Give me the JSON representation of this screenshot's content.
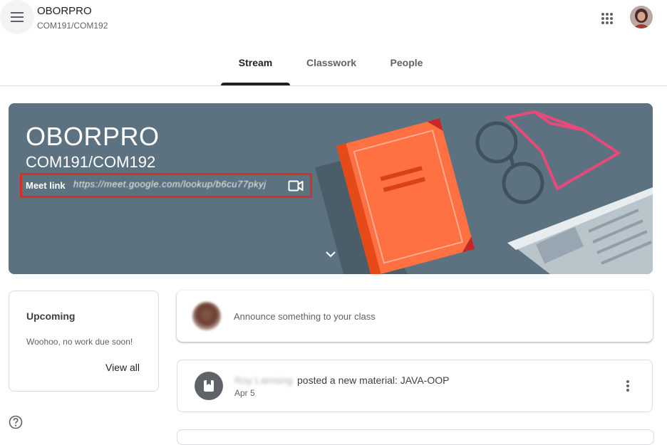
{
  "header": {
    "title": "OBORPRO",
    "subtitle": "COM191/COM192",
    "menu_icon": "hamburger-menu-icon",
    "apps_icon": "apps-grid-icon"
  },
  "tabs": [
    {
      "label": "Stream",
      "active": true
    },
    {
      "label": "Classwork",
      "active": false
    },
    {
      "label": "People",
      "active": false
    }
  ],
  "banner": {
    "title": "OBORPRO",
    "subtitle": "COM191/COM192",
    "meet_label": "Meet link",
    "meet_url": "https://meet.google.com/lookup/b6cu77pkyj",
    "background_color": "#5d7280",
    "highlight_color": "#d93025"
  },
  "upcoming": {
    "title": "Upcoming",
    "message": "Woohoo, no work due soon!",
    "link": "View all"
  },
  "announce": {
    "placeholder": "Announce something to your class"
  },
  "post": {
    "author": "Roy Lamsing",
    "text": "posted a new material: JAVA-OOP",
    "date": "Apr 5"
  }
}
